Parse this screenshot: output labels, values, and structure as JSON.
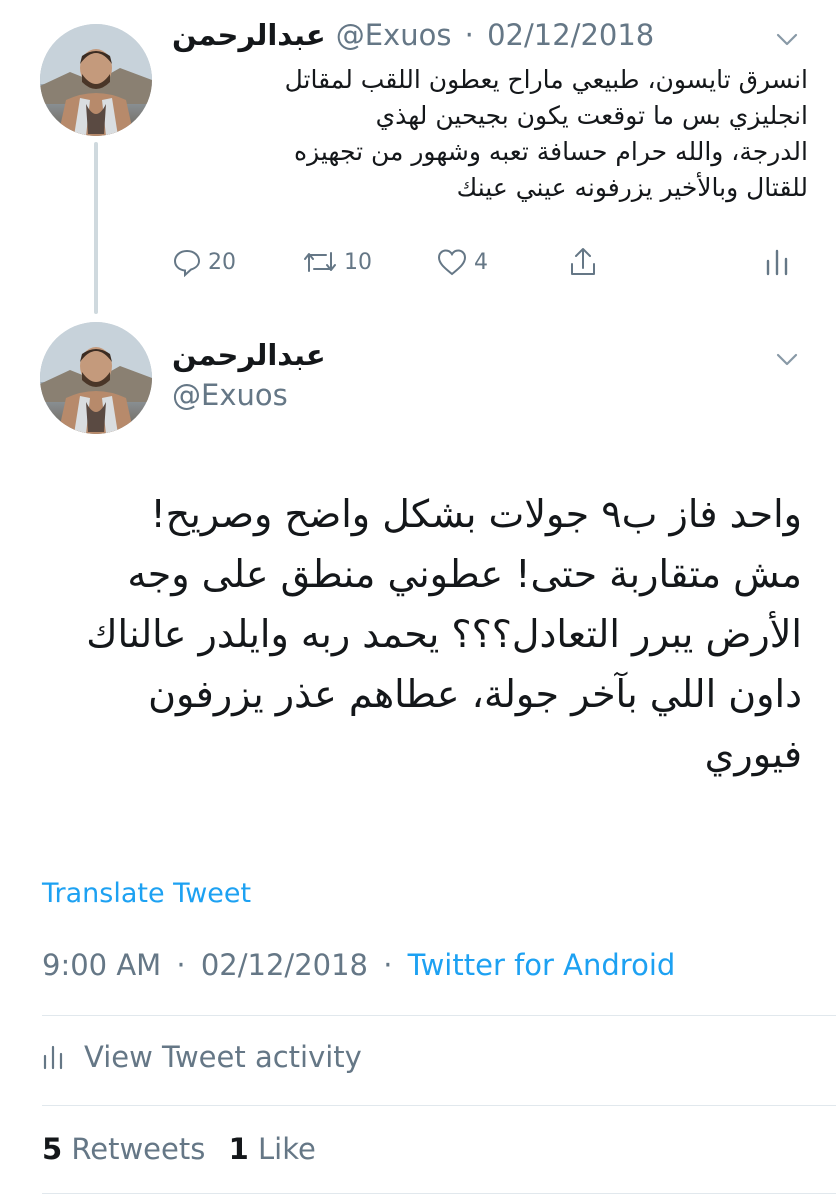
{
  "tweet1": {
    "name": "عبدالرحمن",
    "handle": "@Exuos",
    "separator": "·",
    "date": "02/12/2018",
    "lines": [
      "انسرق تايسون، طبيعي ماراح يعطون اللقب لمقاتل",
      "انجليزي بس ما توقعت يكون بجيحين لهذي",
      "الدرجة، والله حرام حسافة تعبه وشهور من تجهيزه",
      "للقتال وبالأخير يزرفونه عيني عينك"
    ],
    "reply_count": "20",
    "retweet_count": "10",
    "like_count": "4"
  },
  "tweet2": {
    "name": "عبدالرحمن",
    "handle": "@Exuos",
    "lines": [
      "واحد فاز ب٩ جولات بشكل واضح وصريح!",
      "مش متقاربة حتى! عطوني منطق على وجه",
      "الأرض يبرر التعادل؟؟؟ يحمد ربه وايلدر عالناك",
      "داون اللي بآخر جولة، عطاهم عذر يزرفون",
      "فيوري"
    ],
    "translate_label": "Translate Tweet",
    "time": "9:00 AM",
    "separator": "·",
    "date": "02/12/2018",
    "source": "Twitter for Android",
    "activity_label": "View Tweet activity",
    "retweets_count": "5",
    "retweets_label": "Retweets",
    "likes_count": "1",
    "likes_label": "Like"
  },
  "colors": {
    "text": "#14171a",
    "secondary": "#657786",
    "link": "#1da1f2",
    "divider": "#e1e8ed"
  },
  "icons": [
    "chevron-down-icon",
    "reply-icon",
    "retweet-icon",
    "like-icon",
    "share-icon",
    "analytics-icon"
  ]
}
